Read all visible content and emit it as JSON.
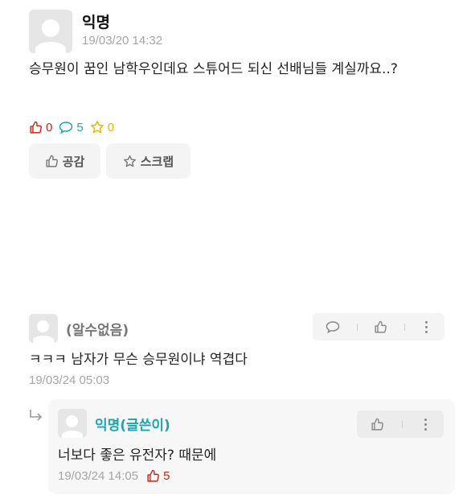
{
  "post": {
    "author": "익명",
    "date": "19/03/20 14:32",
    "content": "승무원이 꿈인 남학우인데요 스튜어드 되신 선배님들 계실까요..?",
    "stats": {
      "likes": "0",
      "comments": "5",
      "scraps": "0"
    },
    "buttons": {
      "like_label": "공감",
      "scrap_label": "스크랩"
    }
  },
  "comments": [
    {
      "author": "(알수없음)",
      "text": "ㅋㅋㅋ 남자가 무슨 승무원이냐 역겹다",
      "date": "19/03/24 05:03"
    }
  ],
  "replies": [
    {
      "author": "익명(글쓴이)",
      "text": "너보다 좋은 유전자? 때문에",
      "date": "19/03/24 14:05",
      "likes": "5"
    }
  ],
  "colors": {
    "like_red": "#c0281c",
    "comment_teal": "#1aa5b5",
    "scrap_gold": "#e6b800",
    "author_teal": "#1aa5b5"
  },
  "icons": [
    "thumb-up-icon",
    "speech-bubble-icon",
    "star-icon",
    "kebab-menu-icon",
    "reply-arrow-icon",
    "avatar-placeholder-icon"
  ]
}
